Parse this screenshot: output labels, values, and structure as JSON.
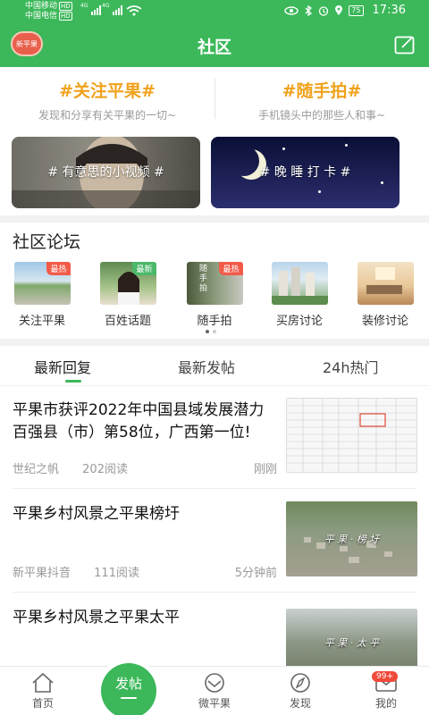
{
  "status_bar": {
    "carrier1": "中国移动",
    "carrier2": "中国电信",
    "hd": "HD",
    "net": "4G",
    "battery": "75",
    "time": "17:36"
  },
  "header": {
    "avatar_text": "新平果",
    "title": "社区"
  },
  "topics": [
    {
      "title": "#关注平果#",
      "subtitle": "发现和分享有关平果的一切~"
    },
    {
      "title": "#随手拍#",
      "subtitle": "手机镜头中的那些人和事~"
    }
  ],
  "banners": [
    {
      "label": "# 有意思的小视频 #"
    },
    {
      "label": "# 晚 睡 打 卡 #"
    }
  ],
  "forum": {
    "title": "社区论坛",
    "items": [
      {
        "label": "关注平果",
        "tag": "最热",
        "tag_type": "hot"
      },
      {
        "label": "百姓话题",
        "tag": "最新",
        "tag_type": "new"
      },
      {
        "label": "随手拍",
        "tag": "最热",
        "tag_type": "hot",
        "img_text": "随手拍"
      },
      {
        "label": "买房讨论",
        "tag": "",
        "tag_type": ""
      },
      {
        "label": "装修讨论",
        "tag": "",
        "tag_type": ""
      }
    ]
  },
  "tabs": [
    {
      "label": "最新回复",
      "active": true
    },
    {
      "label": "最新发帖",
      "active": false
    },
    {
      "label": "24h热门",
      "active": false
    }
  ],
  "posts": [
    {
      "title": "平果市获评2022年中国县域发展潜力百强县（市）第58位，广西第一位!",
      "author": "世纪之帆",
      "reads": "202阅读",
      "time": "刚刚"
    },
    {
      "title": "平果乡村风景之平果榜圩",
      "author": "新平果抖音",
      "reads": "111阅读",
      "time": "5分钟前",
      "thumb_text": "平 果 · 榜 圩"
    },
    {
      "title": "平果乡村风景之平果太平",
      "author": "",
      "reads": "",
      "time": "",
      "thumb_text": "平 果 · 太 平"
    }
  ],
  "bottom_nav": {
    "home": "首页",
    "post": "发帖",
    "wpg": "微平果",
    "discover": "发现",
    "mine": "我的",
    "badge": "99+"
  },
  "colors": {
    "brand": "#3cb85a",
    "accent_orange": "#f0a21c",
    "hot": "#f25b4a"
  }
}
